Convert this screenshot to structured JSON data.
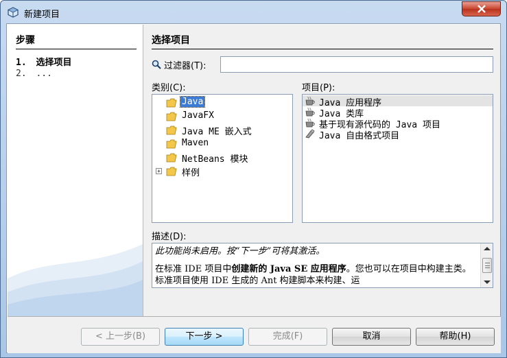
{
  "window": {
    "title": "新建项目"
  },
  "steps": {
    "title": "步骤",
    "items": [
      {
        "num": "1.",
        "label": "选择项目",
        "current": true
      },
      {
        "num": "2.",
        "label": "...",
        "current": false
      }
    ]
  },
  "main": {
    "title": "选择项目",
    "filter": {
      "label": "过滤器(T):",
      "value": "",
      "placeholder": ""
    },
    "categories": {
      "label": "类别(C):",
      "items": [
        "Java",
        "JavaFX",
        "Java ME 嵌入式",
        "Maven",
        "NetBeans 模块",
        "样例"
      ],
      "selected": "Java"
    },
    "projects": {
      "label": "项目(P):",
      "items": [
        "Java 应用程序",
        "Java 类库",
        "基于现有源代码的 Java 项目",
        "Java 自由格式项目"
      ],
      "selected": "Java 应用程序"
    },
    "description": {
      "label": "描述(D):",
      "note": "此功能尚未启用。按“下一步”可将其激活。",
      "p_a": "在标准 IDE 项目中",
      "p_b": "创建新的 Java SE 应用程序",
      "p_c": "。您也可以在项目中构建主类。标准项目使用 IDE 生成的 Ant 构建脚本来构建、运"
    }
  },
  "buttons": {
    "back": "< 上一步(B)",
    "next": "下一步 >",
    "finish": "完成(F)",
    "cancel": "取消",
    "help": "帮助(H)"
  },
  "colors": {
    "selection": "#3a7bd5",
    "titlebar": "#c7daf0",
    "close": "#c8462e"
  }
}
